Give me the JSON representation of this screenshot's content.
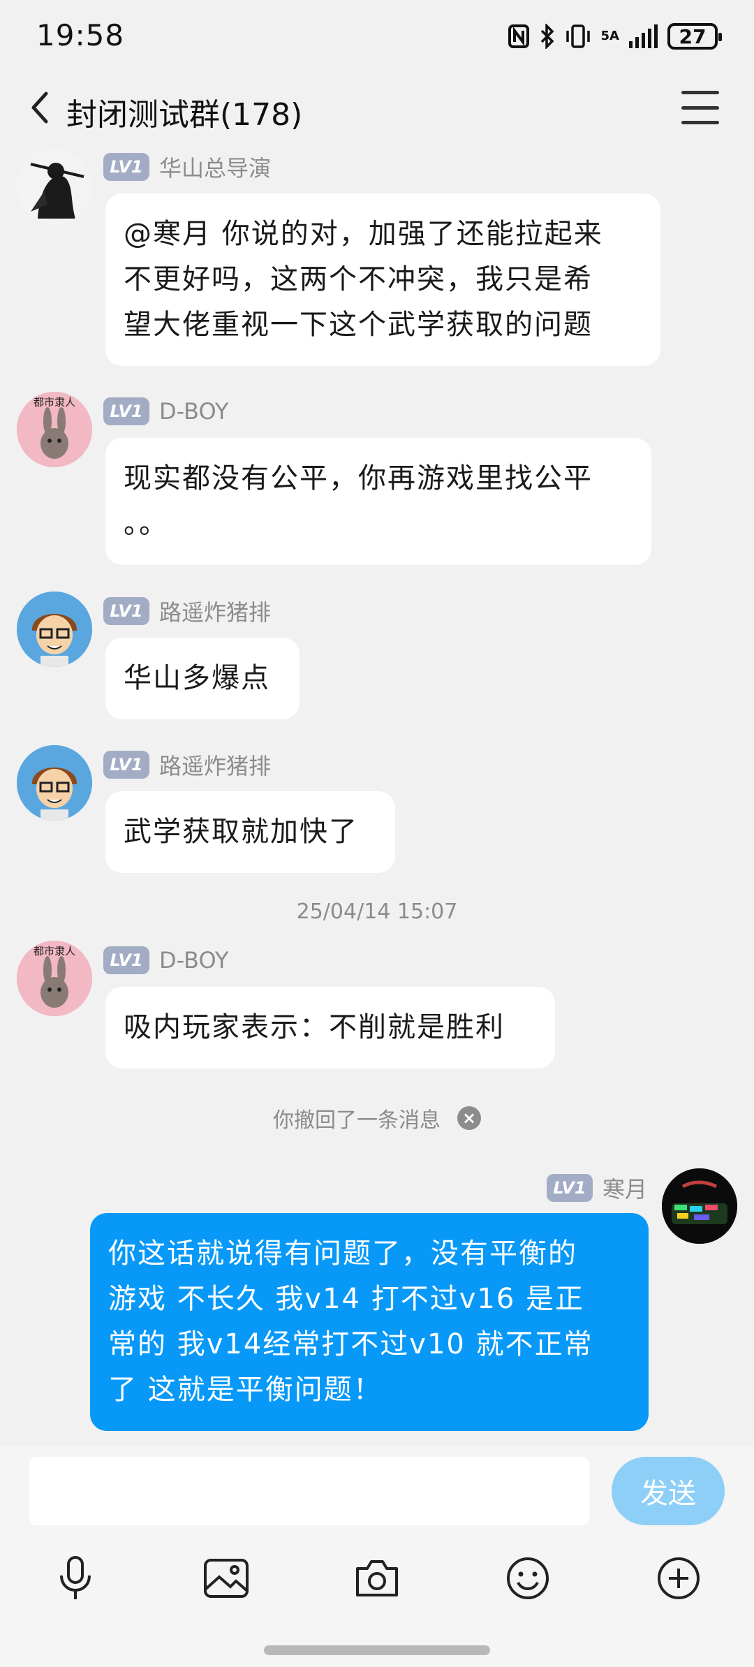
{
  "status_bar": {
    "time": "19:58",
    "network": "5A",
    "battery": "27"
  },
  "header": {
    "title": "封闭测试群(178)"
  },
  "messages": [
    {
      "level": "LV1",
      "name": "华山总导演",
      "lines": [
        "@寒月 你说的对，加强了还能拉起来",
        "不更好吗，这两个不冲突，我只是希",
        "望大佬重视一下这个武学获取的问题"
      ]
    },
    {
      "level": "LV1",
      "name": "D-BOY",
      "lines": [
        "现实都没有公平，你再游戏里找公平",
        "。。"
      ],
      "avatar_text": "都市隶人"
    },
    {
      "level": "LV1",
      "name": "路遥炸猪排",
      "lines": [
        "华山多爆点"
      ]
    },
    {
      "level": "LV1",
      "name": "路遥炸猪排",
      "lines": [
        "武学获取就加快了"
      ]
    },
    {
      "level": "LV1",
      "name": "D-BOY",
      "lines": [
        "吸内玩家表示：不削就是胜利"
      ],
      "avatar_text": "都市隶人"
    },
    {
      "level": "LV1",
      "name": "寒月",
      "lines": [
        "你这话就说得有问题了，没有平衡的",
        "游戏 不长久  我v14 打不过v16 是正",
        "常的  我v14经常打不过v10 就不正常",
        "了  这就是平衡问题！"
      ]
    }
  ],
  "timestamp": "25/04/14 15:07",
  "recall_notice": "你撤回了一条消息",
  "input": {
    "placeholder": "",
    "send_label": "发送"
  },
  "toolbar": [
    "microphone-icon",
    "image-icon",
    "camera-icon",
    "emoji-icon",
    "plus-icon"
  ],
  "colors": {
    "my_bubble": "#0899f8",
    "send_button": "#8ecff8",
    "level_badge": "#a3acc5"
  }
}
